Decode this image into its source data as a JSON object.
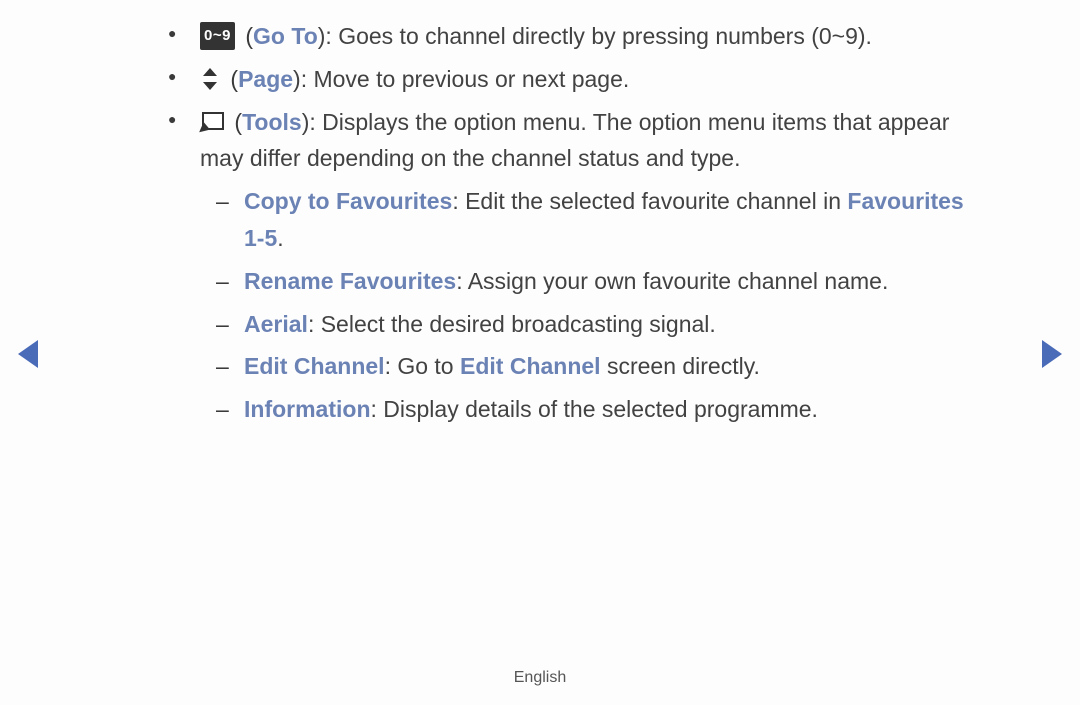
{
  "items": [
    {
      "icon": "09",
      "icon_text": "0~9",
      "label": "Go To",
      "body_parts": [
        {
          "t": "): Goes to channel directly by pressing numbers (0~9)."
        }
      ]
    },
    {
      "icon": "updown",
      "label": "Page",
      "body_parts": [
        {
          "t": "): Move to previous or next page."
        }
      ]
    },
    {
      "icon": "tools",
      "label": "Tools",
      "body_parts": [
        {
          "t": "): Displays the option menu. The option menu items that appear may differ depending on the channel status and type."
        }
      ],
      "sub": [
        {
          "parts": [
            {
              "kw": true,
              "t": "Copy to Favourites"
            },
            {
              "kw": false,
              "t": ": Edit the selected favourite channel in "
            },
            {
              "kw": true,
              "t": "Favourites 1-5"
            },
            {
              "kw": false,
              "t": "."
            }
          ]
        },
        {
          "parts": [
            {
              "kw": true,
              "t": "Rename Favourites"
            },
            {
              "kw": false,
              "t": ": Assign your own favourite channel name."
            }
          ]
        },
        {
          "parts": [
            {
              "kw": true,
              "t": "Aerial"
            },
            {
              "kw": false,
              "t": ": Select the desired broadcasting signal."
            }
          ]
        },
        {
          "parts": [
            {
              "kw": true,
              "t": "Edit Channel"
            },
            {
              "kw": false,
              "t": ": Go to "
            },
            {
              "kw": true,
              "t": "Edit Channel"
            },
            {
              "kw": false,
              "t": " screen directly."
            }
          ]
        },
        {
          "parts": [
            {
              "kw": true,
              "t": "Information"
            },
            {
              "kw": false,
              "t": ": Display details of the selected programme."
            }
          ]
        }
      ]
    }
  ],
  "footer": "English"
}
